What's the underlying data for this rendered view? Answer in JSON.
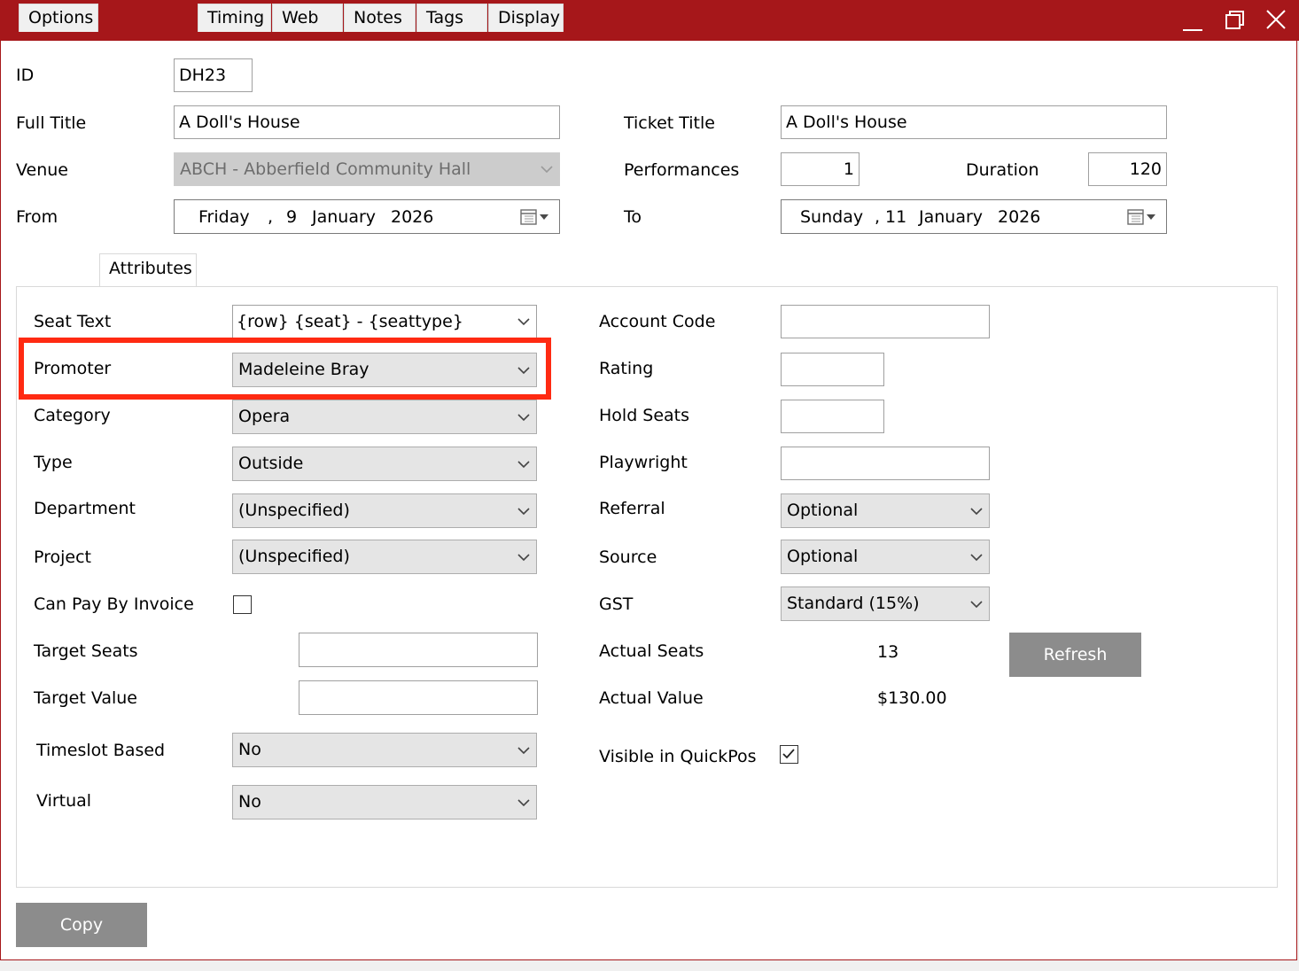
{
  "window": {
    "minimize_glyph": "_",
    "maximize_glyph": "□",
    "close_glyph": "✕"
  },
  "header": {
    "id_label": "ID",
    "id_value": "DH23",
    "full_title_label": "Full Title",
    "full_title_value": "A Doll's House",
    "ticket_title_label": "Ticket Title",
    "ticket_title_value": "A Doll's House",
    "venue_label": "Venue",
    "venue_value": "ABCH - Abberfield Community Hall",
    "performances_label": "Performances",
    "performances_value": "1",
    "duration_label": "Duration",
    "duration_value": "120",
    "from_label": "From",
    "from_date": {
      "weekday": "Friday",
      "sep": ",",
      "day": "9",
      "month": "January",
      "year": "2026"
    },
    "to_label": "To",
    "to_date": {
      "weekday": "Sunday",
      "sep": ",",
      "day": "11",
      "month": "January",
      "year": "2026"
    }
  },
  "tabs": [
    {
      "label": "Options"
    },
    {
      "label": "Attributes",
      "active": true
    },
    {
      "label": "Timing"
    },
    {
      "label": "Web"
    },
    {
      "label": "Notes"
    },
    {
      "label": "Tags"
    },
    {
      "label": "Display"
    }
  ],
  "attributes": {
    "left": {
      "seat_text": {
        "label": "Seat Text",
        "value": "{row} {seat} - {seattype}"
      },
      "promoter": {
        "label": "Promoter",
        "value": "Madeleine Bray"
      },
      "category": {
        "label": "Category",
        "value": "Opera"
      },
      "type": {
        "label": "Type",
        "value": "Outside"
      },
      "department": {
        "label": "Department",
        "value": "(Unspecified)"
      },
      "project": {
        "label": "Project",
        "value": "(Unspecified)"
      },
      "can_pay_by_invoice": {
        "label": "Can Pay By Invoice",
        "checked": false
      },
      "target_seats": {
        "label": "Target Seats",
        "value": ""
      },
      "target_value": {
        "label": "Target Value",
        "value": ""
      },
      "timeslot_based": {
        "label": "Timeslot Based",
        "value": "No"
      },
      "virtual": {
        "label": "Virtual",
        "value": "No"
      }
    },
    "right": {
      "account_code": {
        "label": "Account Code",
        "value": ""
      },
      "rating": {
        "label": "Rating",
        "value": ""
      },
      "hold_seats": {
        "label": "Hold Seats",
        "value": ""
      },
      "playwright": {
        "label": "Playwright",
        "value": ""
      },
      "referral": {
        "label": "Referral",
        "value": "Optional"
      },
      "source": {
        "label": "Source",
        "value": "Optional"
      },
      "gst": {
        "label": "GST",
        "value": "Standard (15%)"
      },
      "actual_seats": {
        "label": "Actual Seats",
        "value": "13"
      },
      "actual_value": {
        "label": "Actual Value",
        "value": "$130.00"
      },
      "refresh_label": "Refresh",
      "visible_in_quickpos": {
        "label": "Visible in QuickPos",
        "checked": true
      }
    }
  },
  "footer": {
    "copy_label": "Copy"
  },
  "colors": {
    "titlebar": "#a6171a",
    "highlight": "#ff2a12",
    "button_gray": "#8c8c8c"
  }
}
